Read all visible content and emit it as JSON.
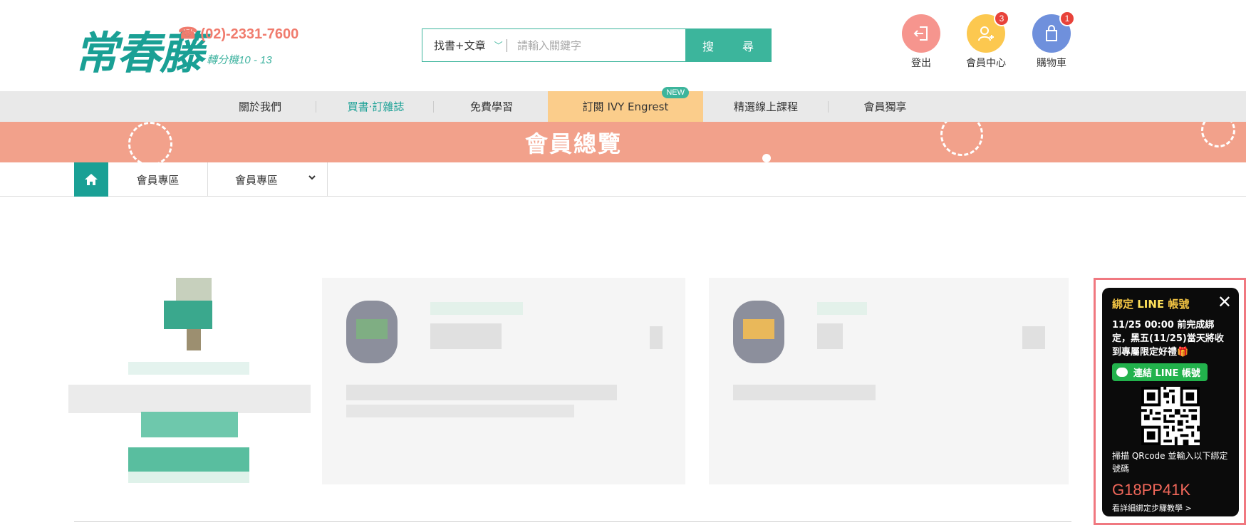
{
  "header": {
    "logo_text": "常春藤",
    "phone": "(02)-2331-7600",
    "extension": "轉分機10 - 13",
    "search": {
      "category": "找書+文章",
      "placeholder": "請輸入關鍵字",
      "button_label": "搜　尋"
    },
    "icons": [
      {
        "name": "logout-icon",
        "label": "登出",
        "color": "#f6958e"
      },
      {
        "name": "member-icon",
        "label": "會員中心",
        "color": "#fcc84f",
        "badge": "3"
      },
      {
        "name": "cart-icon",
        "label": "購物車",
        "color": "#6f90dc",
        "badge": "1"
      }
    ]
  },
  "nav": {
    "items": [
      {
        "label": "關於我們"
      },
      {
        "label": "買書‧訂雜誌",
        "active": true
      },
      {
        "label": "免費學習"
      },
      {
        "label": "訂閱 IVY Engrest",
        "badge": "NEW"
      },
      {
        "label": "精選線上課程"
      },
      {
        "label": "會員獨享"
      }
    ]
  },
  "banner": {
    "title": "會員總覽"
  },
  "breadcrumb": {
    "item1": "會員專區",
    "item2": "會員專區"
  },
  "line_popup": {
    "title_prefix": "綁定 ",
    "title_line": "LINE",
    "title_suffix": " 帳號",
    "close": "✕",
    "body": "11/25 00:00 前完成綁定，黑五(11/25)當天將收到專屬限定好禮🎁",
    "button_label": "連結 LINE 帳號",
    "scan_text": "掃描 QRcode 並輸入以下綁定號碼",
    "code": "G18PP41K",
    "link_text": "看詳細綁定步驟教學 >"
  },
  "colors": {
    "brand_teal": "#1aa095",
    "accent_green": "#3cb59c",
    "banner_salmon": "#f2a18b",
    "line_green": "#22b24c",
    "popup_border": "#f07880"
  }
}
